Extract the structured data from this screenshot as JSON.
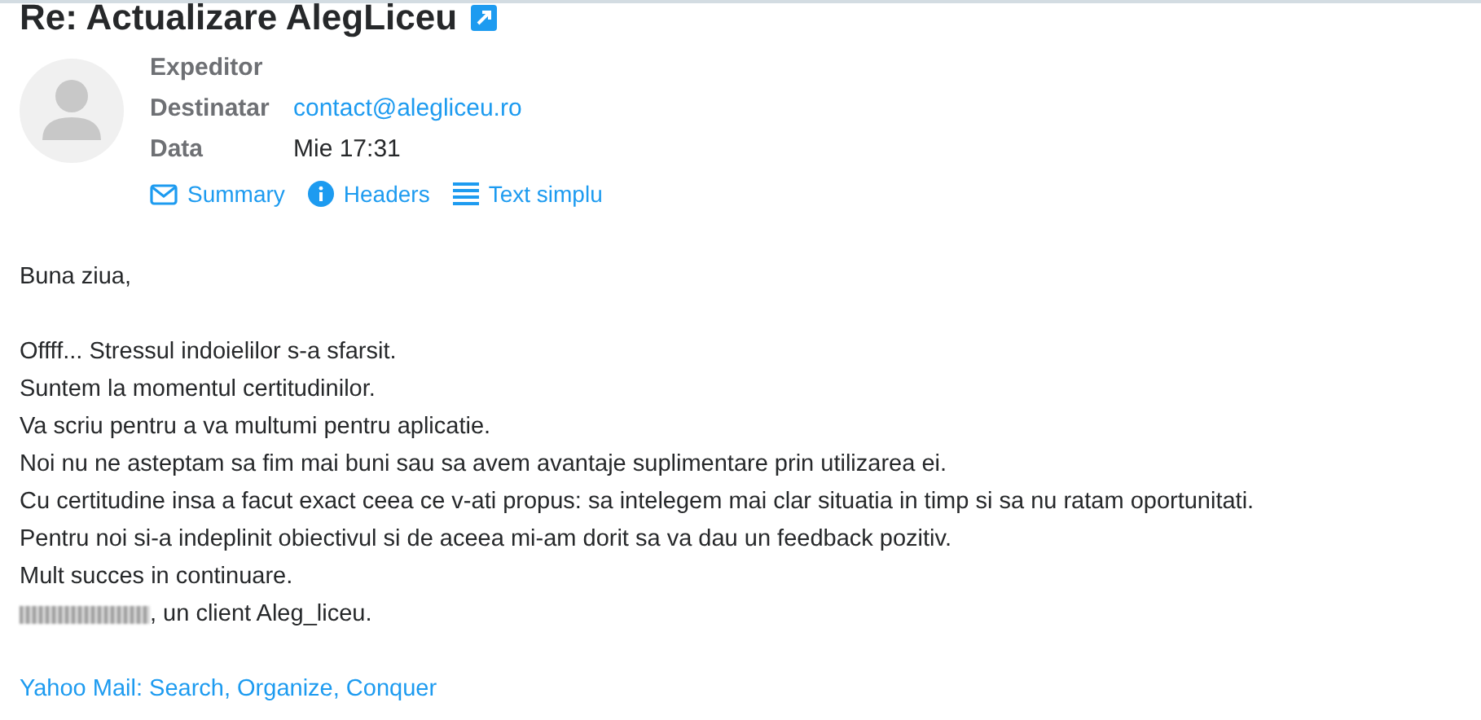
{
  "subject": "Re: Actualizare AlegLiceu",
  "header": {
    "fields": [
      {
        "label": "Expeditor",
        "kind": "redacted"
      },
      {
        "label": "Destinatar",
        "value": "contact@alegliceu.ro",
        "kind": "link"
      },
      {
        "label": "Data",
        "value": "Mie 17:31",
        "kind": "text"
      }
    ],
    "actions": [
      {
        "label": "Summary",
        "kind": "envelope"
      },
      {
        "label": "Headers",
        "kind": "info"
      },
      {
        "label": "Text simplu",
        "kind": "lines"
      }
    ]
  },
  "body": [
    {
      "kind": "text",
      "text": "Buna ziua,"
    },
    {
      "kind": "blank"
    },
    {
      "kind": "text",
      "text": "Offff... Stressul indoielilor s-a sfarsit."
    },
    {
      "kind": "text",
      "text": "Suntem la momentul certitudinilor."
    },
    {
      "kind": "text",
      "text": "Va scriu pentru a va multumi pentru aplicatie."
    },
    {
      "kind": "text",
      "text": "Noi nu ne asteptam sa fim mai buni sau sa avem avantaje suplimentare prin utilizarea ei."
    },
    {
      "kind": "text",
      "text": "Cu certitudine insa a facut exact ceea ce v-ati propus: sa intelegem mai clar situatia in timp si sa nu ratam oportunitati."
    },
    {
      "kind": "text",
      "text": "Pentru noi si-a indeplinit obiectivul si de aceea mi-am dorit sa va dau un feedback pozitiv."
    },
    {
      "kind": "text",
      "text": "Mult succes in continuare."
    },
    {
      "kind": "signature",
      "text": ", un client Aleg_liceu."
    },
    {
      "kind": "blank"
    },
    {
      "kind": "link",
      "text": "Yahoo Mail: Search, Organize, Conquer"
    }
  ]
}
